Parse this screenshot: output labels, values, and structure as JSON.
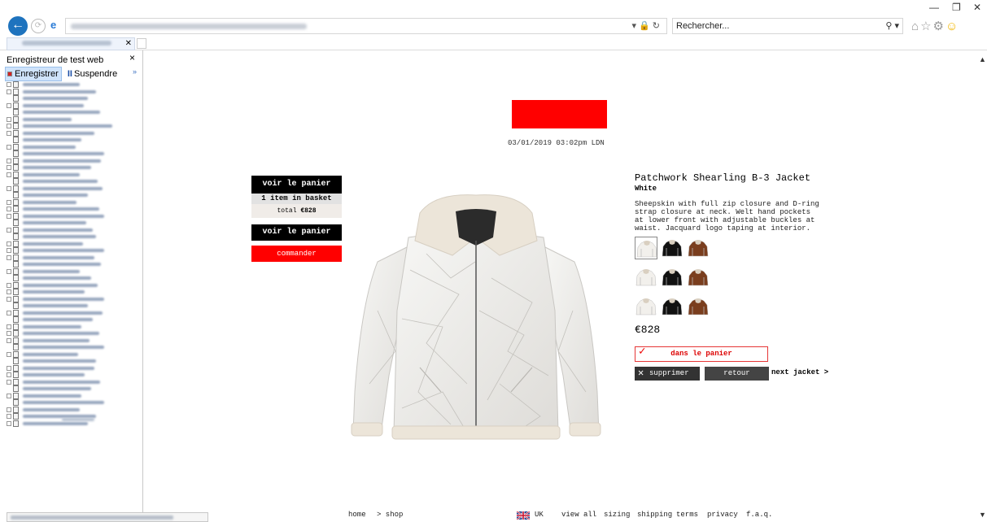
{
  "browser": {
    "back_icon": "back-arrow-icon",
    "search_placeholder": "Rechercher...",
    "search_glyph": "⚲ ▾",
    "addr_icons": "▾ 🔒 ↻",
    "win_min": "—",
    "win_restore": "❐",
    "win_close": "✕",
    "fwd_glyph": "⟳",
    "ie_glyph": "e",
    "tab_close": "✕"
  },
  "panel": {
    "title": "Enregistreur de test web",
    "close": "×",
    "record_label": "Enregistrer",
    "pause_label": "Suspendre",
    "pause_glyph": "II",
    "more_glyph": "»"
  },
  "site": {
    "datetime": "03/01/2019 03:02pm LDN",
    "cart": {
      "view_cart_top": "voir le panier",
      "count": "1 item in basket",
      "total_label": "total",
      "total_value": "€828",
      "view_cart": "voir le panier",
      "checkout": "commander"
    },
    "product": {
      "title": "Patchwork Shearling B-3 Jacket",
      "color": "White",
      "description": "Sheepskin with full zip closure and D-ring strap closure at neck. Welt hand pockets at lower front with adjustable buckles at waist. Jacquard logo taping at interior.",
      "price": "€828",
      "in_cart": "dans le panier",
      "check_glyph": "✓",
      "remove": "supprimer",
      "remove_glyph": "✕",
      "back": "retour",
      "next": "next jacket >",
      "swatch_colors": [
        "#f2f0ec",
        "#111111",
        "#7a3e1e",
        "#f2f0ec",
        "#111111",
        "#7a3e1e",
        "#f2f0ec",
        "#111111",
        "#7a3e1e"
      ]
    },
    "footer": {
      "home": "home",
      "shop": "> shop",
      "region": "UK",
      "view_all": "view all",
      "sizing": "sizing",
      "shipping": "shipping",
      "terms": "terms",
      "privacy": "privacy",
      "faq": "f.a.q."
    },
    "accent": "#ff0000"
  },
  "scroll": {
    "up": "▲",
    "down": "▼"
  }
}
